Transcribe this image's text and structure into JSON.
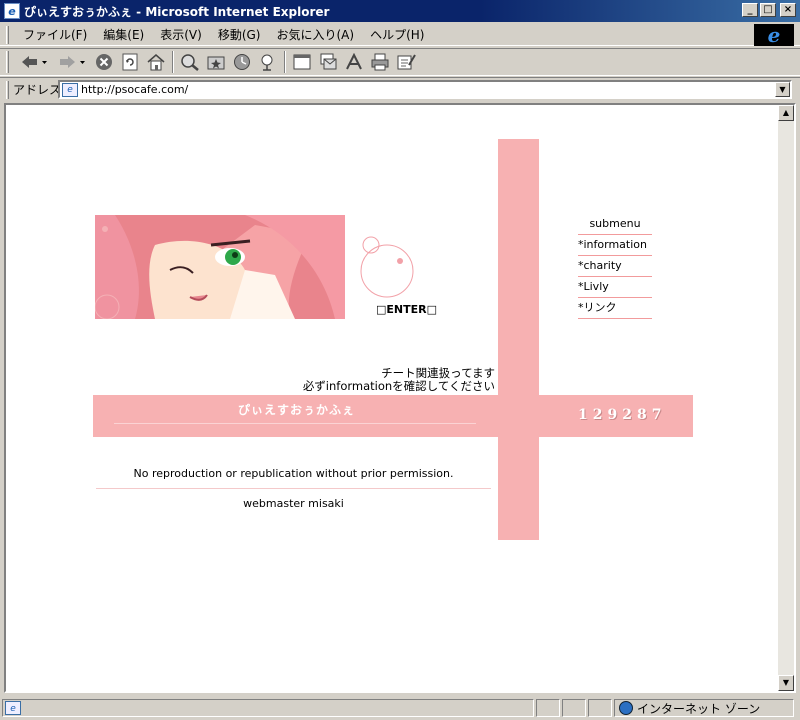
{
  "window": {
    "title": "ぴぃえすおぅかふぇ - Microsoft Internet Explorer",
    "minimize": "_",
    "maximize": "□",
    "close": "×"
  },
  "menu": {
    "items": [
      "ファイル(F)",
      "編集(E)",
      "表示(V)",
      "移動(G)",
      "お気に入り(A)",
      "ヘルプ(H)"
    ]
  },
  "toolbar": {
    "buttons": [
      "back-icon",
      "forward-icon",
      "stop-icon",
      "refresh-icon",
      "home-icon",
      "search-icon",
      "favorites-icon",
      "history-icon",
      "channels-icon",
      "fullscreen-icon",
      "mail-icon",
      "font-icon",
      "print-icon",
      "edit-icon"
    ]
  },
  "address": {
    "label": "アドレス",
    "url": "http://psocafe.com/"
  },
  "page": {
    "enter": "□ENTER□",
    "submenu": {
      "header": "submenu",
      "items": [
        "*information",
        "*charity",
        "*Livly",
        "*リンク"
      ]
    },
    "notice_line1": "チート関連扱ってます",
    "notice_line2": "必ずinformationを確認してください",
    "site_title": "ぴぃえすおぅかふぇ",
    "counter": "129287",
    "copyright": "No reproduction or republication without prior permission.",
    "webmaster": "webmaster misaki"
  },
  "status": {
    "zone": "インターネット ゾーン"
  },
  "colors": {
    "accent_pink": "#f7b1b2",
    "titlebar": "#0a246a"
  }
}
